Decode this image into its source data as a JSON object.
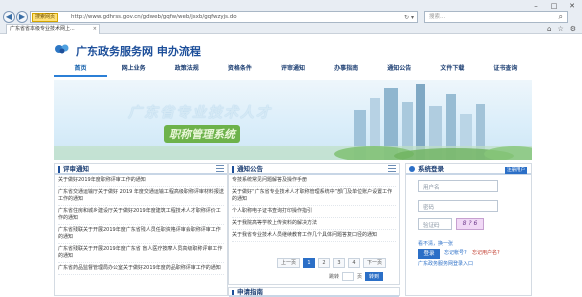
{
  "browser": {
    "url": "http://www.gdhrss.gov.cn/gdweb/gqfw/web/jsxb/gqfwzyjs.do",
    "address_tag": "搜索网页",
    "search_placeholder": "搜索...",
    "tab_title": "广东省省本级专业技术网上..."
  },
  "site": {
    "title": "广东政务服务网  申办流程",
    "menu": [
      {
        "label": "首页",
        "active": true
      },
      {
        "label": "网上业务"
      },
      {
        "label": "政策法规"
      },
      {
        "label": "资格条件"
      },
      {
        "label": "评审通知"
      },
      {
        "label": "办事指南"
      },
      {
        "label": "通知公告"
      },
      {
        "label": "文件下载"
      },
      {
        "label": "证书查询"
      }
    ],
    "banner_line1": "广东省专业技术人才",
    "banner_line2": "职称管理系统"
  },
  "review_panel": {
    "title": "评审通知",
    "items": [
      "关于做好2019年度职称评审工作的通知",
      "广东省交通运输厅关于做好 2019 年度交通运输工程高级职称评审材料报送工作的通知",
      "广东省住房和城乡建设厅关于做好2019年度建筑工程技术人才职称评价工作的通知",
      "广东省残联关于开展2019年度广东省残人员任职资格评审会职称评审工作的通知",
      "广东省残联关于开展2019年度广东省 盲人医疗按摩人员高级职称评审工作的通知",
      "广东省药品监督管理局办公室关于做好2019年度药品职称评审工作的通知"
    ]
  },
  "notice_panel": {
    "title": "通知公告",
    "items": [
      "专技系统常见问题解答及操作手册",
      "关于做好“广东省专业技术人才职称管理系统中”部门及单位账户设置工作的通知",
      "个人职称电子证书查询打印操作指引",
      "关于我院高等学校上传资料的解决方法",
      "关于我省专业技术人员继续教育工作几个具体问题答复口径的通知"
    ],
    "pager": [
      "上一页",
      "1",
      "2",
      "3",
      "4",
      "下一页"
    ],
    "pager_current": "1",
    "jump_label": "跳转",
    "page_unit": "页",
    "go_label": "转到"
  },
  "login_panel": {
    "title": "系统登录",
    "register_badge": "注册用户",
    "username_placeholder": "用户名",
    "password_placeholder": "密码",
    "captcha_placeholder": "验证码",
    "captcha_text": "8 ? 6",
    "refresh_text": "看不清，换一张",
    "login_label": "登录",
    "forgot_label": "忘记帐号?",
    "forgot_pwd_label": "忘记用户名?",
    "entry_link": "广东政务服务网登录入口"
  },
  "section_below": {
    "title": "申请指南"
  }
}
